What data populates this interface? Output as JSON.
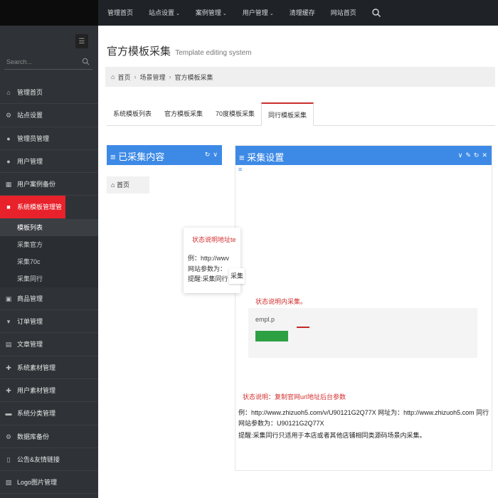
{
  "topnav": {
    "items": [
      {
        "label": "管理首页",
        "has_dropdown": false
      },
      {
        "label": "站点设置",
        "has_dropdown": true
      },
      {
        "label": "案例管理",
        "has_dropdown": true
      },
      {
        "label": "用户管理",
        "has_dropdown": true
      },
      {
        "label": "清理缓存",
        "has_dropdown": false
      },
      {
        "label": "网站首页",
        "has_dropdown": false
      }
    ],
    "search_icon": "search-icon",
    "chevron": "⌄"
  },
  "sidebar": {
    "search_placeholder": "Search...",
    "menu": [
      {
        "label": "管理首页",
        "icon": "home-icon",
        "glyph": "⌂"
      },
      {
        "label": "站点设置",
        "icon": "gears-icon",
        "glyph": "⚙"
      },
      {
        "label": "管理员管理",
        "icon": "user-icon",
        "glyph": "●"
      },
      {
        "label": "用户管理",
        "icon": "user-icon",
        "glyph": "●"
      },
      {
        "label": "用户案例备份",
        "icon": "table-icon",
        "glyph": "▦"
      },
      {
        "label": "系统模板管理管",
        "icon": "briefcase-icon",
        "glyph": "■",
        "active": true
      }
    ],
    "submenu": [
      {
        "label": "模板列表",
        "current": true
      },
      {
        "label": "采集官方"
      },
      {
        "label": "采集70c"
      },
      {
        "label": "采集同行"
      }
    ],
    "menu_after": [
      {
        "label": "商品管理",
        "icon": "box-icon",
        "glyph": "▣"
      },
      {
        "label": "订单管理",
        "icon": "cart-icon",
        "glyph": "▾"
      },
      {
        "label": "文章管理",
        "icon": "doc-icon",
        "glyph": "▤"
      },
      {
        "label": "系统素材管理",
        "icon": "gift-icon",
        "glyph": "✚"
      },
      {
        "label": "用户素材管理",
        "icon": "gift-icon",
        "glyph": "✚"
      },
      {
        "label": "系统分类管理",
        "icon": "folder-icon",
        "glyph": "▬"
      },
      {
        "label": "数据库备份",
        "icon": "gears-icon",
        "glyph": "⚙"
      },
      {
        "label": "公告&友情链接",
        "icon": "bookmark-icon",
        "glyph": "▯"
      },
      {
        "label": "Logo图片管理",
        "icon": "image-icon",
        "glyph": "▧"
      }
    ]
  },
  "page": {
    "title": "官方模板采集",
    "subtitle": "Template editing system"
  },
  "breadcrumb": {
    "home": "首页",
    "level2": "场景管理",
    "current": "官方模板采集",
    "sep": "›"
  },
  "tabs": [
    {
      "label": "系统模板列表"
    },
    {
      "label": "官方模板采集"
    },
    {
      "label": "70度模板采集"
    },
    {
      "label": "同行模板采集",
      "active": true
    }
  ],
  "panel_collected": {
    "title": "≡ 已采集内容",
    "breadcrumb_home": "首页",
    "icons": [
      "refresh-icon",
      "chevron-down-icon"
    ],
    "icon_glyphs": {
      "refresh": "↻",
      "chevron": "∨",
      "wrench": "✎",
      "close": "✕"
    }
  },
  "panel_settings": {
    "title": "≡ 采集设置",
    "subtitle": "≡",
    "icons": [
      "chevron-down-icon",
      "wrench-icon",
      "refresh-icon",
      "close-icon"
    ],
    "status_label": "状态说明内采集。",
    "template_input_value": "empl.p",
    "hint_status": "状态说明：复制官网url地址后台参数",
    "hint_example": "例：http://www.zhizuoh5.com/v/U90121G2Q77X 网址为：http://www.zhizuoh5.com 同行网站参数为：U90121G2Q77X",
    "hint_tip": "提醒:采集同行只适用于本店或者其他店铺相同类源码场景内采集。"
  },
  "popup": {
    "status": "状态说明地址te",
    "line1": "例：http://wwv",
    "line2": "网站参数为：",
    "line3": "提醒:采集同行",
    "badge": "采集"
  },
  "colors": {
    "topbar": "#1f2328",
    "sidebar": "#2f3337",
    "active_menu": "#e8212b",
    "panel_header": "#3d8ae6",
    "tab_active_border": "#c9302c",
    "status_red": "#d32f2f",
    "save_green": "#2ea044"
  }
}
